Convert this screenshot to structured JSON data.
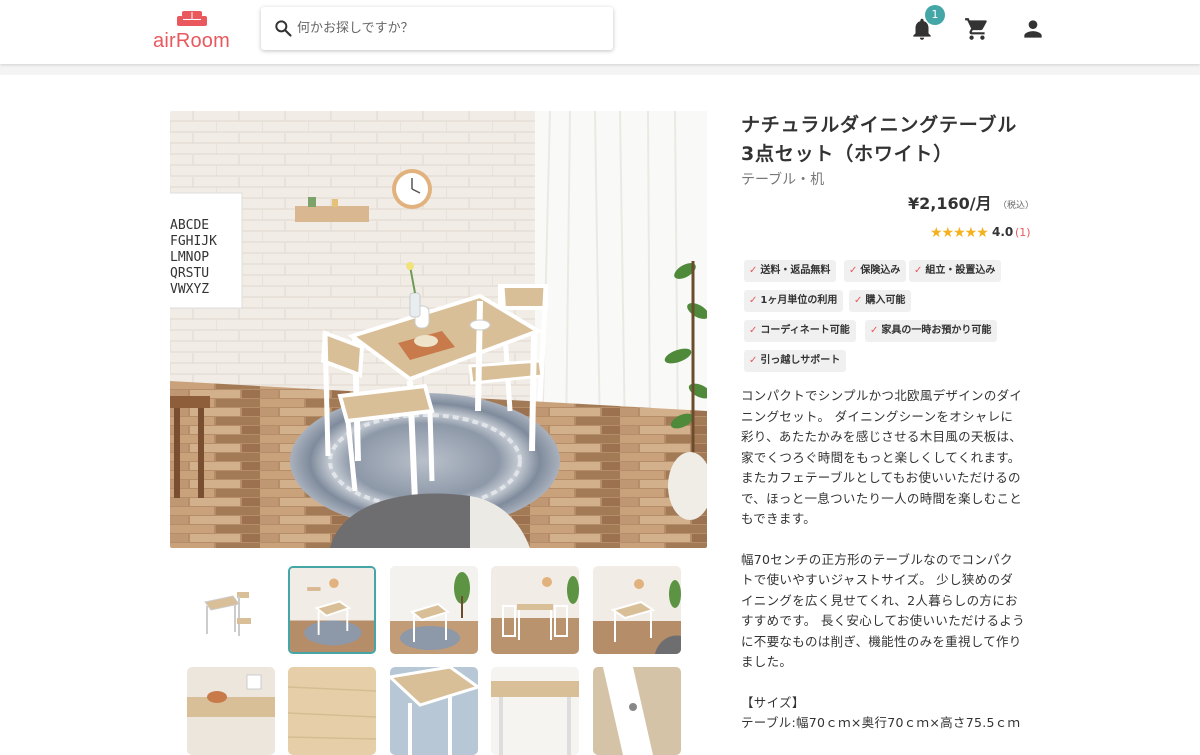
{
  "header": {
    "logo_text": "airRoom",
    "search_placeholder": "何かお探しですか？",
    "notification_count": "1",
    "brand_color": "#e8585d",
    "accent_color": "#44a6a7",
    "icons": [
      "search-icon",
      "bell-icon",
      "cart-icon",
      "account-icon"
    ]
  },
  "product": {
    "title": "ナチュラルダイニングテーブル3点セット（ホワイト）",
    "category": "テーブル・机",
    "price": "¥2,160/月",
    "tax_note": "（税込）",
    "rating": {
      "stars": "★★★★★",
      "value": "4.0",
      "count": "(1)",
      "fraction": 0.8
    },
    "tags": [
      "送料・返品無料",
      "保険込み",
      "組立・設置込み",
      "1ヶ月単位の利用",
      "購入可能",
      "コーディネート可能",
      "家具の一時お預かり可能",
      "引っ越しサポート"
    ],
    "description": [
      "コンパクトでシンプルかつ北欧風デザインのダイニングセット。 ダイニングシーンをオシャレに彩り、あたたかみを感じさせる木目風の天板は、家でくつろぐ時間をもっと楽しくしてくれます。 またカフェテーブルとしてもお使いいただけるので、ほっと一息ついたり一人の時間を楽しむこともできます。",
      "幅70センチの正方形のテーブルなのでコンパクトで使いやすいジャストサイズ。 少し狭めのダイニングを広く見せてくれ、2人暮らしの方におすすめです。 長く安心してお使いいただけるように不要なものは削ぎ、機能性のみを重視して作りました。",
      "【サイズ】",
      "テーブル:幅70ｃｍ×奥行70ｃｍ×高さ75.5ｃｍ"
    ]
  },
  "gallery": {
    "main_alt": "ダイニングテーブルセットの部屋の写真",
    "thumbnail_count": 10,
    "selected_index": 1
  }
}
